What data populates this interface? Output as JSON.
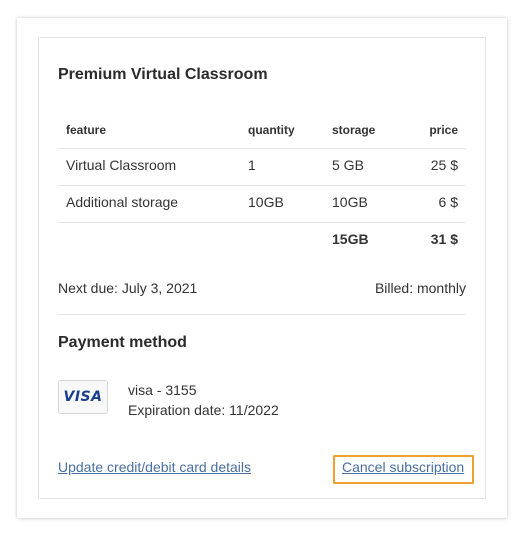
{
  "plan": {
    "title": "Premium Virtual Classroom"
  },
  "table": {
    "headers": {
      "feature": "feature",
      "quantity": "quantity",
      "storage": "storage",
      "price": "price"
    },
    "rows": [
      {
        "feature": "Virtual Classroom",
        "quantity": "1",
        "storage": "5 GB",
        "price": "25 $"
      },
      {
        "feature": "Additional storage",
        "quantity": "10GB",
        "storage": "10GB",
        "price": "6 $"
      }
    ],
    "total": {
      "storage": "15GB",
      "price": "31 $"
    }
  },
  "billing": {
    "next_due": "Next due: July 3, 2021",
    "billed": "Billed: monthly"
  },
  "payment": {
    "title": "Payment method",
    "card_brand": "VISA",
    "card_icon": "visa-card-icon",
    "card_label": "visa - 3155",
    "expiration": "Expiration date: 11/2022"
  },
  "actions": {
    "update_card": "Update credit/debit card details",
    "cancel": "Cancel subscription"
  },
  "colors": {
    "link": "#4a6fa1",
    "highlight": "#f0a030",
    "visa_blue": "#1a3f8f"
  }
}
